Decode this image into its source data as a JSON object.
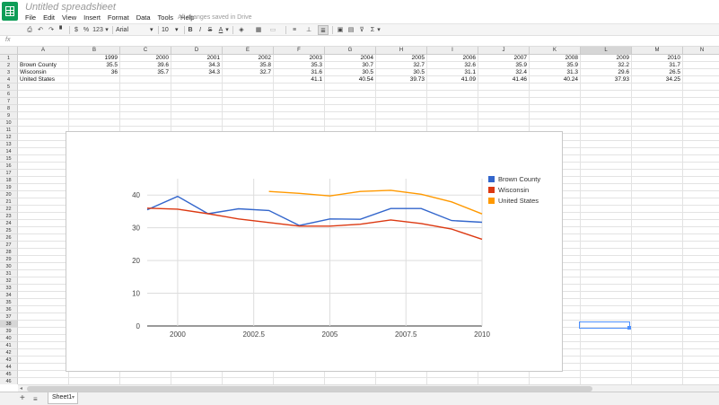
{
  "header": {
    "title": "Untitled spreadsheet",
    "save_status": "All changes saved in Drive",
    "menu": [
      "File",
      "Edit",
      "View",
      "Insert",
      "Format",
      "Data",
      "Tools",
      "Help"
    ]
  },
  "toolbar": {
    "dollar": "$",
    "percent": "%",
    "number_format": "123",
    "font": "Arial",
    "font_size": "10",
    "bold": "B",
    "italic": "I",
    "strike": "S",
    "text_color": "A",
    "sum": "Σ"
  },
  "formula_bar": {
    "label": "fx"
  },
  "columns": [
    "A",
    "B",
    "C",
    "D",
    "E",
    "F",
    "G",
    "H",
    "I",
    "J",
    "K",
    "L",
    "M",
    "N"
  ],
  "selected_column": "L",
  "selected_row": 38,
  "rows_visible": 46,
  "sheet": {
    "rows": [
      [
        "",
        "1999",
        "2000",
        "2001",
        "2002",
        "2003",
        "2004",
        "2005",
        "2006",
        "2007",
        "2008",
        "2009",
        "2010"
      ],
      [
        "Brown County",
        "35.5",
        "39.6",
        "34.3",
        "35.8",
        "35.3",
        "30.7",
        "32.7",
        "32.6",
        "35.9",
        "35.9",
        "32.2",
        "31.7"
      ],
      [
        "Wisconsin",
        "36",
        "35.7",
        "34.3",
        "32.7",
        "31.6",
        "30.5",
        "30.5",
        "31.1",
        "32.4",
        "31.3",
        "29.6",
        "26.5"
      ],
      [
        "United States",
        "",
        "",
        "",
        "",
        "41.1",
        "40.54",
        "39.73",
        "41.09",
        "41.46",
        "40.24",
        "37.93",
        "34.25"
      ]
    ]
  },
  "chart_data": {
    "type": "line",
    "x_ticks": [
      "2000",
      "2002.5",
      "2005",
      "2007.5",
      "2010"
    ],
    "y_ticks": [
      "0",
      "10",
      "20",
      "30",
      "40"
    ],
    "xlim": [
      1999,
      2010
    ],
    "ylim": [
      0,
      45
    ],
    "grid": true,
    "legend": "right",
    "series": [
      {
        "name": "Brown County",
        "color": "#3366cc",
        "x": [
          1999,
          2000,
          2001,
          2002,
          2003,
          2004,
          2005,
          2006,
          2007,
          2008,
          2009,
          2010
        ],
        "y": [
          35.5,
          39.6,
          34.3,
          35.8,
          35.3,
          30.7,
          32.7,
          32.6,
          35.9,
          35.9,
          32.2,
          31.7
        ]
      },
      {
        "name": "Wisconsin",
        "color": "#dc3912",
        "x": [
          1999,
          2000,
          2001,
          2002,
          2003,
          2004,
          2005,
          2006,
          2007,
          2008,
          2009,
          2010
        ],
        "y": [
          36,
          35.7,
          34.3,
          32.7,
          31.6,
          30.5,
          30.5,
          31.1,
          32.4,
          31.3,
          29.6,
          26.5
        ]
      },
      {
        "name": "United States",
        "color": "#ff9900",
        "x": [
          2003,
          2004,
          2005,
          2006,
          2007,
          2008,
          2009,
          2010
        ],
        "y": [
          41.1,
          40.54,
          39.73,
          41.09,
          41.46,
          40.24,
          37.93,
          34.25
        ]
      }
    ]
  },
  "sheet_tabs": [
    {
      "label": "Sheet1"
    }
  ],
  "icons": {
    "add_sheet": "+",
    "sheets_list": "≡",
    "star": "☆",
    "chevron": "▾"
  }
}
